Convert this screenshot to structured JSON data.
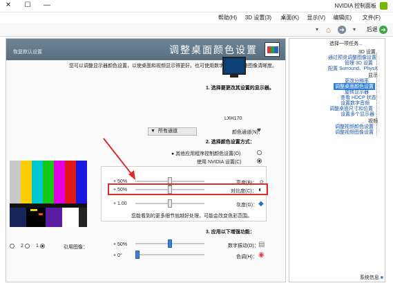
{
  "window": {
    "title": "NVIDIA 控制面板",
    "close_glyph": "✕",
    "maximize_glyph": "☐",
    "minimize_glyph": "—"
  },
  "menu": [
    "文件(F)",
    "编辑(E)",
    "显示(V)",
    "桌面(K)",
    "3D 设置(3)",
    "帮助(H)"
  ],
  "toolbar": {
    "back_label": "后退",
    "back_glyph": "➜",
    "home_glyph": "⌂",
    "forward_glyph": "➜"
  },
  "page": {
    "title": "调整桌面颜色设置",
    "restore_defaults": "恢复默认设置",
    "description_line1": "您可以调整显示器颜色设置，以使桌面和视频显示得更好。也可使用数字振动来调整图像清晰度。",
    "section1_title": "1. 选择要更改其设置的显示器。",
    "monitor_label": "LXH170",
    "section2_title": "2. 选择颜色设置方式：",
    "radio_other": "● 其他应用程序控制颜色设置(O)",
    "radio_nvidia": "使用 NVIDIA 设置(C)",
    "color_channel_label": "颜色通道(N)：",
    "color_channel_value": "所有通道",
    "brightness_label": "亮度(B)：",
    "brightness_value": "+ 50%",
    "contrast_label": "对比度(C)：",
    "contrast_value": "+ 50%",
    "gamma_label": "灰度(G)：",
    "gamma_value": "+ 1.00",
    "gamma_note": "您能看到的更多细节就越好处理，可能会改变色彩范围。",
    "section3_title": "3. 应用以下增强功能：",
    "vibrance_label": "数字振动(D)：",
    "vibrance_value": "+ 50%",
    "hue_label": "色调(H)：",
    "hue_value": "+ 0°",
    "reference_label": "引用图像：",
    "ref_options": [
      "1",
      "2",
      "3"
    ],
    "footer_link": "系统信息"
  },
  "sidebar": {
    "header": "选择一项任务...",
    "categories": [
      {
        "label": "3D 设置",
        "items": [
          "通过预览调整图像设置",
          "管理 3D 设置",
          "配置 Surround、PhysX"
        ]
      },
      {
        "label": "显示",
        "items": [
          "更改分辨率",
          "调整桌面颜色设置",
          "旋转显示器",
          "查看 HDCP 状态",
          "设置数字音频",
          "调整桌面尺寸和位置",
          "设置多个显示器"
        ]
      },
      {
        "label": "视频",
        "items": [
          "调整视频颜色设置",
          "调整视频图像设置"
        ]
      }
    ]
  },
  "colors": {
    "banner": "#6d8597",
    "highlight_red": "#e02a2a",
    "selected_blue": "#2f7fd8",
    "link_blue": "#1a55a6",
    "nvidia_green": "#76b900"
  },
  "levels": {
    "brightness": 0.5,
    "contrast": 0.5,
    "gamma": 0.5,
    "vibrance": 0.5,
    "hue": 0.0
  },
  "icons": [
    "close-icon",
    "maximize-icon",
    "minimize-icon",
    "nvidia-icon",
    "back-icon",
    "home-icon",
    "forward-icon",
    "monitor-icon",
    "brightness-icon",
    "contrast-icon",
    "gamma-icon",
    "hue-icon",
    "arrow-annotation-icon"
  ]
}
